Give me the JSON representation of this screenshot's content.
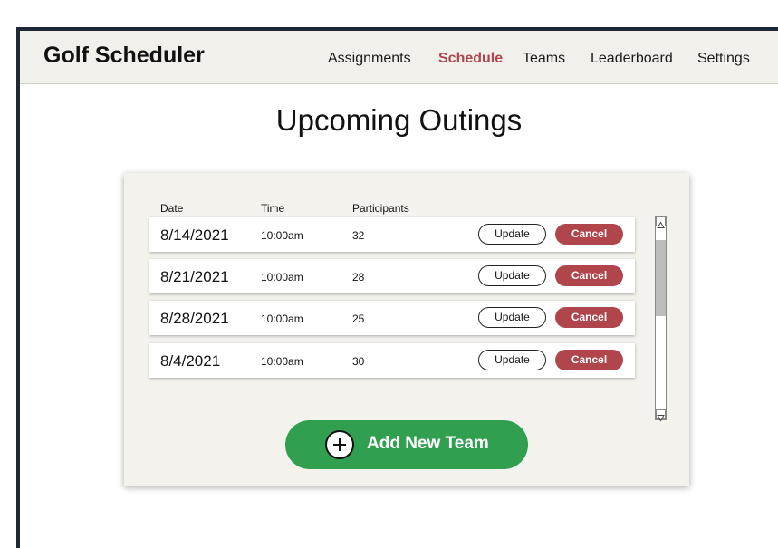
{
  "header": {
    "app_title": "Golf Scheduler",
    "nav": [
      "Assignments",
      "Schedule",
      "Teams",
      "Leaderboard",
      "Settings"
    ],
    "active_nav": "Schedule"
  },
  "main": {
    "heading": "Upcoming Outings",
    "columns": [
      "Date",
      "Time",
      "Participants"
    ],
    "rows": [
      {
        "date": "8/14/2021",
        "time": "10:00am",
        "participants": "32"
      },
      {
        "date": "8/21/2021",
        "time": "10:00am",
        "participants": "28"
      },
      {
        "date": "8/28/2021",
        "time": "10:00am",
        "participants": "25"
      },
      {
        "date": "8/4/2021",
        "time": "10:00am",
        "participants": "30"
      }
    ],
    "update_label": "Update",
    "cancel_label": "Cancel",
    "add_label": "Add New Team"
  },
  "colors": {
    "accent": "#b04550",
    "cancel": "#b0454c",
    "add_button": "#30a050",
    "frame": "#1e2a33"
  },
  "icons": {
    "add": "plus-circle-icon",
    "scroll_up": "triangle-up-icon",
    "scroll_down": "triangle-down-icon"
  }
}
